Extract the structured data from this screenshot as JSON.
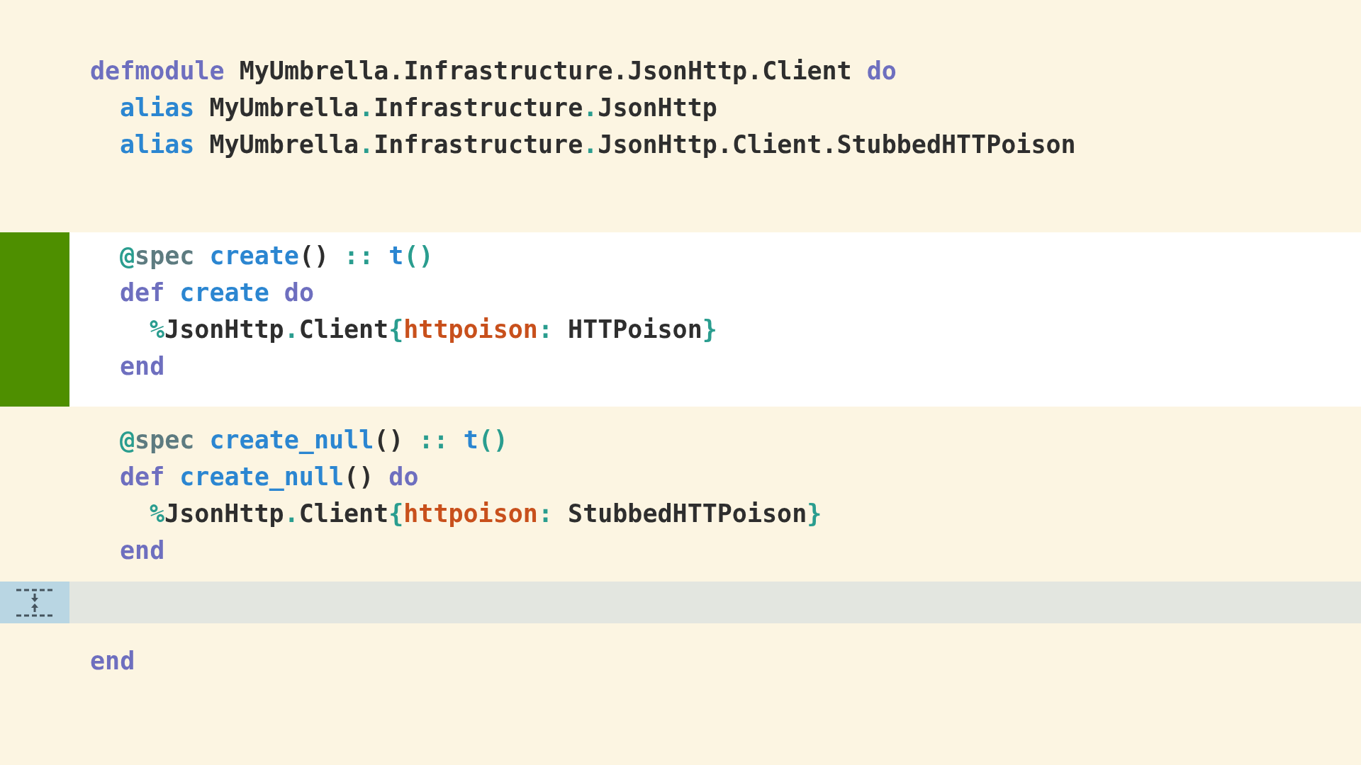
{
  "sections": [
    {
      "kind": "plain",
      "lines": [
        {
          "tokens": [
            {
              "kind": "kw",
              "text": "defmodule"
            },
            {
              "kind": "tx",
              "text": " MyUmbrella.Infrastructure.JsonHttp.Client "
            },
            {
              "kind": "kw",
              "text": "do"
            }
          ],
          "children": [
            {
              "tokens": [
                {
                  "kind": "fn",
                  "text": "alias"
                },
                {
                  "kind": "tx",
                  "text": " MyUmbrella"
                },
                {
                  "kind": "pu",
                  "text": "."
                },
                {
                  "kind": "tx",
                  "text": "Infrastructure"
                },
                {
                  "kind": "pu",
                  "text": "."
                },
                {
                  "kind": "tx",
                  "text": "JsonHttp"
                }
              ]
            },
            {
              "tokens": [
                {
                  "kind": "fn",
                  "text": "alias"
                },
                {
                  "kind": "tx",
                  "text": " MyUmbrella"
                },
                {
                  "kind": "pu",
                  "text": "."
                },
                {
                  "kind": "tx",
                  "text": "Infrastructure"
                },
                {
                  "kind": "pu",
                  "text": "."
                },
                {
                  "kind": "tx",
                  "text": "JsonHttp.Client.StubbedHTTPoison"
                }
              ]
            }
          ]
        }
      ]
    },
    {
      "kind": "added",
      "lines": [
        {
          "tokens": [
            {
              "kind": "pu",
              "text": "@"
            },
            {
              "kind": "at",
              "text": "spec "
            },
            {
              "kind": "fn",
              "text": "create"
            },
            {
              "kind": "tx",
              "text": "() "
            },
            {
              "kind": "pu",
              "text": ":: "
            },
            {
              "kind": "fn",
              "text": "t"
            },
            {
              "kind": "pu",
              "text": "()"
            }
          ]
        },
        {
          "tokens": [
            {
              "kind": "kw",
              "text": "def "
            },
            {
              "kind": "fn",
              "text": "create "
            },
            {
              "kind": "kw",
              "text": "do"
            }
          ],
          "children": [
            {
              "tokens": [
                {
                  "kind": "pu",
                  "text": "%"
                },
                {
                  "kind": "tx",
                  "text": "JsonHttp"
                },
                {
                  "kind": "pu",
                  "text": "."
                },
                {
                  "kind": "tx",
                  "text": "Client"
                },
                {
                  "kind": "pu",
                  "text": "{"
                },
                {
                  "kind": "at2",
                  "text": "httpoison"
                },
                {
                  "kind": "pu",
                  "text": ":"
                },
                {
                  "kind": "tx",
                  "text": " HTTPoison"
                },
                {
                  "kind": "pu",
                  "text": "}"
                }
              ]
            }
          ]
        },
        {
          "tokens": [
            {
              "kind": "kw",
              "text": "end"
            }
          ]
        }
      ]
    },
    {
      "kind": "plain",
      "lines": [
        {
          "tokens": [
            {
              "kind": "pu",
              "text": "@"
            },
            {
              "kind": "at",
              "text": "spec "
            },
            {
              "kind": "fn",
              "text": "create_null"
            },
            {
              "kind": "tx",
              "text": "() "
            },
            {
              "kind": "pu",
              "text": ":: "
            },
            {
              "kind": "fn",
              "text": "t"
            },
            {
              "kind": "pu",
              "text": "()"
            }
          ]
        },
        {
          "tokens": [
            {
              "kind": "kw",
              "text": "def "
            },
            {
              "kind": "fn",
              "text": "create_null"
            },
            {
              "kind": "tx",
              "text": "() "
            },
            {
              "kind": "kw",
              "text": "do"
            }
          ],
          "children": [
            {
              "tokens": [
                {
                  "kind": "pu",
                  "text": "%"
                },
                {
                  "kind": "tx",
                  "text": "JsonHttp"
                },
                {
                  "kind": "pu",
                  "text": "."
                },
                {
                  "kind": "tx",
                  "text": "Client"
                },
                {
                  "kind": "pu",
                  "text": "{"
                },
                {
                  "kind": "at2",
                  "text": "httpoison"
                },
                {
                  "kind": "pu",
                  "text": ":"
                },
                {
                  "kind": "tx",
                  "text": " StubbedHTTPoison"
                },
                {
                  "kind": "pu",
                  "text": "}"
                }
              ]
            }
          ]
        },
        {
          "tokens": [
            {
              "kind": "kw",
              "text": "end"
            }
          ]
        }
      ]
    },
    {
      "kind": "fold"
    },
    {
      "kind": "plain",
      "lines": [
        {
          "tokens": [
            {
              "kind": "kw",
              "text": "end"
            }
          ]
        }
      ]
    }
  ]
}
